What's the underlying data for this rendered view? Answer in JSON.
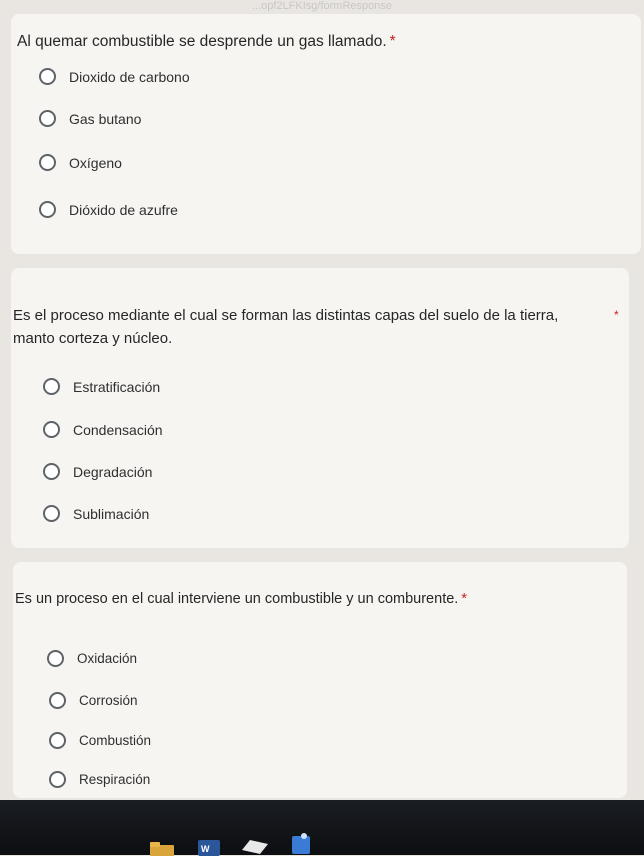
{
  "browser": {
    "url_fragment": "...opf2LFKIsg/formResponse"
  },
  "questions": [
    {
      "title": "Al quemar combustible se desprende un gas llamado.",
      "required_mark": "*",
      "options": [
        "Dioxido de carbono",
        "Gas butano",
        "Oxígeno",
        "Dióxido de azufre"
      ]
    },
    {
      "title": "Es el proceso mediante el cual se forman las distintas capas del suelo de la tierra, manto corteza y núcleo.",
      "required_mark": "*",
      "options": [
        "Estratificación",
        "Condensación",
        "Degradación",
        "Sublimación"
      ]
    },
    {
      "title": "Es un proceso en el cual interviene un combustible y un comburente.",
      "required_mark": "*",
      "options": [
        "Oxidación",
        "Corrosión",
        "Combustión",
        "Respiración"
      ]
    }
  ],
  "taskbar": {
    "icons": [
      "folder-icon",
      "word-icon",
      "drive-icon",
      "photos-icon"
    ],
    "colors": {
      "word": "#2b579a",
      "drive": "#e8e8e8",
      "photos": "#3a7bd5"
    }
  }
}
